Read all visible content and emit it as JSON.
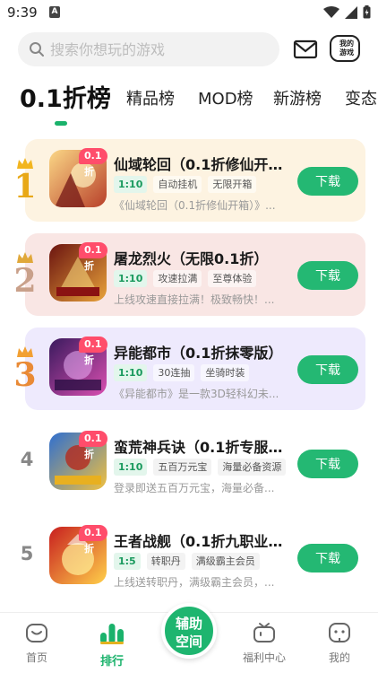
{
  "status": {
    "time": "9:39",
    "a_label": "A"
  },
  "search": {
    "placeholder": "搜索你想玩的游戏"
  },
  "header": {
    "my_games_line1": "我的",
    "my_games_line2": "游戏"
  },
  "tabs": [
    "0.1折榜",
    "精品榜",
    "MOD榜",
    "新游榜",
    "变态"
  ],
  "badge": "0.1折",
  "download_label": "下载",
  "colors": {
    "accent": "#1ab26b",
    "button": "#24b873",
    "badge": "#ff4d6b"
  },
  "games": [
    {
      "rank": "1",
      "title": "仙域轮回（0.1折修仙开箱...",
      "ratio": "1:10",
      "tags": [
        "自动挂机",
        "无限开箱"
      ],
      "desc": "《仙域轮回（0.1折修仙开箱）》...",
      "bg": "#fdf3e1"
    },
    {
      "rank": "2",
      "title": "屠龙烈火（无限0.1折）",
      "ratio": "1:10",
      "tags": [
        "攻速拉满",
        "至尊体验"
      ],
      "desc": "上线攻速直接拉满！极致畅快！...",
      "bg": "#f9e6e4"
    },
    {
      "rank": "3",
      "title": "异能都市（0.1折抹零版）",
      "ratio": "1:10",
      "tags": [
        "30连抽",
        "坐骑时装"
      ],
      "desc": "《异能都市》是一款3D轻科幻未...",
      "bg": "#eeeafd"
    },
    {
      "rank": "4",
      "title": "蛮荒神兵诀（0.1折专服版...",
      "ratio": "1:10",
      "tags": [
        "五百万元宝",
        "海量必备资源"
      ],
      "desc": "登录即送五百万元宝，海量必备...",
      "bg": "#ffffff"
    },
    {
      "rank": "5",
      "title": "王者战舰（0.1折九职业打...",
      "ratio": "1:5",
      "tags": [
        "转职丹",
        "满级霸主会员"
      ],
      "desc": "上线送转职丹，满级霸主会员，...",
      "bg": "#ffffff"
    }
  ],
  "bottom_nav": {
    "home": "首页",
    "rank": "排行",
    "assist_line1": "辅助",
    "assist_line2": "空间",
    "welfare": "福利中心",
    "mine": "我的"
  }
}
